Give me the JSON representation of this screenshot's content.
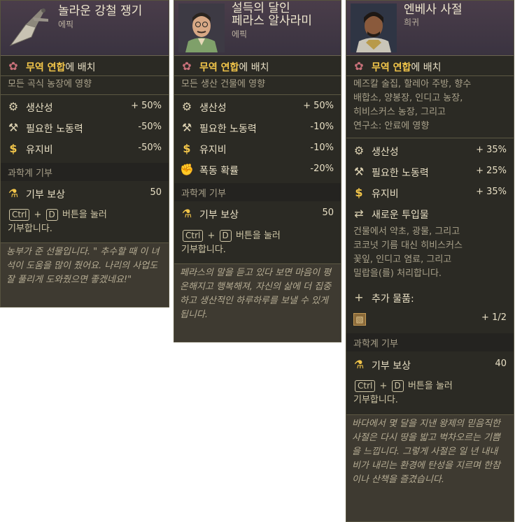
{
  "cards": [
    {
      "title": "놀라운 강철 쟁기",
      "rarity": "에픽",
      "trade_prefix": "무역 연합",
      "trade_suffix": "에 배치",
      "affects": "모든 곡식 농장에 영향",
      "stats": [
        {
          "icon": "productivity-icon",
          "label": "생산성",
          "value": "+ 50%"
        },
        {
          "icon": "tools-icon",
          "label": "필요한 노동력",
          "value": "-50%"
        },
        {
          "icon": "dollar-icon",
          "label": "유지비",
          "value": "-50%"
        }
      ],
      "section": "과학계 기부",
      "reward_label": "기부 보상",
      "reward_value": "50",
      "ctrl_key": "Ctrl",
      "plus": "+",
      "d_key": "D",
      "ctrl_text1": "버튼을 눌러",
      "ctrl_text2": "기부합니다.",
      "quote": "농부가 준 선물입니다. \" 추수할 때 이 녀석이 도움을 많이 줬어요. 나리의 사업도 잘 풀리게 도와줬으면 좋겠네요!\""
    },
    {
      "title_line1": "설득의 달인",
      "title_line2": "페라스 알사라미",
      "rarity": "에픽",
      "trade_prefix": "무역 연합",
      "trade_suffix": "에 배치",
      "affects": "모든 생산 건물에 영향",
      "stats": [
        {
          "icon": "productivity-icon",
          "label": "생산성",
          "value": "+ 50%"
        },
        {
          "icon": "tools-icon",
          "label": "필요한 노동력",
          "value": "-10%"
        },
        {
          "icon": "dollar-icon",
          "label": "유지비",
          "value": "-10%"
        },
        {
          "icon": "fist-icon",
          "label": "폭동 확률",
          "value": "-20%"
        }
      ],
      "section": "과학계 기부",
      "reward_label": "기부 보상",
      "reward_value": "50",
      "ctrl_key": "Ctrl",
      "plus": "+",
      "d_key": "D",
      "ctrl_text1": "버튼을 눌러",
      "ctrl_text2": "기부합니다.",
      "quote": "페라스의 말을 듣고 있다 보면 마음이 평온해지고 행복해져, 자신의 삶에 더 집중하고 생산적인 하루하루를 보낼 수 있게 됩니다."
    },
    {
      "title": "엔베사 사절",
      "rarity": "희귀",
      "trade_prefix": "무역 연합",
      "trade_suffix": "에 배치",
      "affects_lines": [
        "메즈칼 술집, 할레아 주방, 향수",
        "배합소, 양봉장, 인디고 농장,",
        "히비스커스 농장, 그리고",
        "연구소: 안료에 영향"
      ],
      "stats": [
        {
          "icon": "productivity-icon",
          "label": "생산성",
          "value": "+ 35%"
        },
        {
          "icon": "tools-icon",
          "label": "필요한 노동력",
          "value": "+ 25%"
        },
        {
          "icon": "dollar-icon",
          "label": "유지비",
          "value": "+ 35%"
        }
      ],
      "new_input_label": "새로운 투입물",
      "new_input_lines": [
        "건물에서 약초, 광물, 그리고",
        "코코넛 기름 대신 히비스커스",
        "꽃잎, 인디고 염료, 그리고",
        "밀랍을(를) 처리합니다."
      ],
      "extra_label": "추가 물품:",
      "extra_value": "+ 1/2",
      "section": "과학계 기부",
      "reward_label": "기부 보상",
      "reward_value": "40",
      "ctrl_key": "Ctrl",
      "plus": "+",
      "d_key": "D",
      "ctrl_text1": "버튼을 눌러",
      "ctrl_text2": "기부합니다.",
      "quote": "바다에서 몇 달을 지낸 왕제의 믿음직한 사절은 다시 땅을 밟고 벅차오르는 기쁨을 느낍니다. 그렇게 사절은 일 년 내내 비가 내리는 환경에 탄성을 지르며 한참이나 산책을 즐겼습니다."
    }
  ]
}
